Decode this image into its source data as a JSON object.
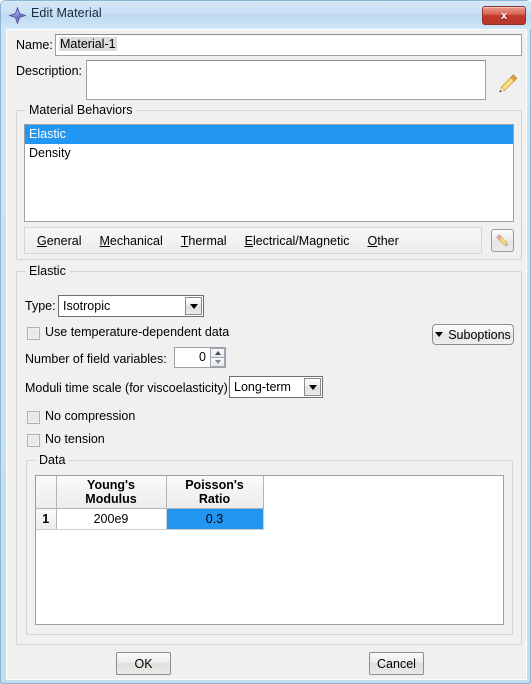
{
  "window": {
    "title": "Edit Material",
    "icon": "abaqus-diamond-icon",
    "close_label": "x",
    "accent_blue": "#2196f3",
    "frame_blue": "#c9e0f4"
  },
  "fields": {
    "name_label": "Name:",
    "name_value": "Material-1",
    "description_label": "Description:",
    "description_value": "",
    "description_placeholder": ""
  },
  "material_behaviors": {
    "group_title": "Material Behaviors",
    "items": [
      {
        "label": "Elastic",
        "selected": true
      },
      {
        "label": "Density",
        "selected": false
      }
    ],
    "menu": [
      {
        "mnemonic": "G",
        "rest": "eneral"
      },
      {
        "mnemonic": "M",
        "rest": "echanical"
      },
      {
        "mnemonic": "T",
        "rest": "hermal"
      },
      {
        "mnemonic": "E",
        "rest": "lectrical/Magnetic"
      },
      {
        "mnemonic": "O",
        "rest": "ther"
      }
    ],
    "edit_button_icon": "pencil-icon"
  },
  "elastic": {
    "group_title": "Elastic",
    "type_label": "Type:",
    "type_value": "Isotropic",
    "suboptions_label": "Suboptions",
    "temp_dependent_label": "Use temperature-dependent data",
    "temp_dependent_checked": false,
    "field_vars_label": "Number of field variables:",
    "field_vars_value": "0",
    "moduli_label": "Moduli time scale (for viscoelasticity):",
    "moduli_value": "Long-term",
    "no_compression_label": "No compression",
    "no_compression_checked": false,
    "no_tension_label": "No tension",
    "no_tension_checked": false
  },
  "data_table": {
    "group_title": "Data",
    "columns": [
      "Young's\nModulus",
      "Poisson's\nRatio"
    ],
    "col1_line1": "Young's",
    "col1_line2": "Modulus",
    "col2_line1": "Poisson's",
    "col2_line2": "Ratio",
    "rows": [
      {
        "index": "1",
        "youngs_modulus": "200e9",
        "poissons_ratio": "0.3",
        "selected_cell": "poissons_ratio"
      }
    ]
  },
  "buttons": {
    "ok": "OK",
    "cancel": "Cancel"
  }
}
